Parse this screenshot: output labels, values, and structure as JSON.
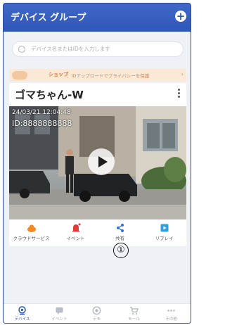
{
  "header": {
    "title": "デバイス  グループ",
    "add_icon": "plus-circle-icon"
  },
  "search": {
    "placeholder": "デバイス名またはIDを入力します"
  },
  "banner": {
    "label": "ショップ",
    "text": "：IDアップロードでプライバシーを保護",
    "arrow": "›"
  },
  "device": {
    "name": "ゴマちゃん-W",
    "timestamp": "24/03/21 12:04:48",
    "id": "ID:8888888888"
  },
  "actions": [
    {
      "label": "クラウドサービス",
      "icon": "cloud-service-icon",
      "color": "#f08a24"
    },
    {
      "label": "イベント",
      "icon": "event-bell-icon",
      "color": "#e23b3b"
    },
    {
      "label": "共有",
      "icon": "share-icon",
      "color": "#2f6fd8"
    },
    {
      "label": "リプレイ",
      "icon": "replay-icon",
      "color": "#2fa0e0"
    }
  ],
  "annotation": {
    "label": "①"
  },
  "bottom_nav": [
    {
      "label": "デバイス",
      "icon": "device-icon",
      "active": true
    },
    {
      "label": "イベント",
      "icon": "event-message-icon",
      "active": false
    },
    {
      "label": "デモ",
      "icon": "demo-icon",
      "active": false
    },
    {
      "label": "モール",
      "icon": "cart-icon",
      "active": false
    },
    {
      "label": "その他",
      "icon": "more-icon",
      "active": false
    }
  ],
  "colors": {
    "primary": "#2f57b8",
    "banner_bg": "#fbe9d8",
    "screen_bg": "#eef1f6"
  }
}
